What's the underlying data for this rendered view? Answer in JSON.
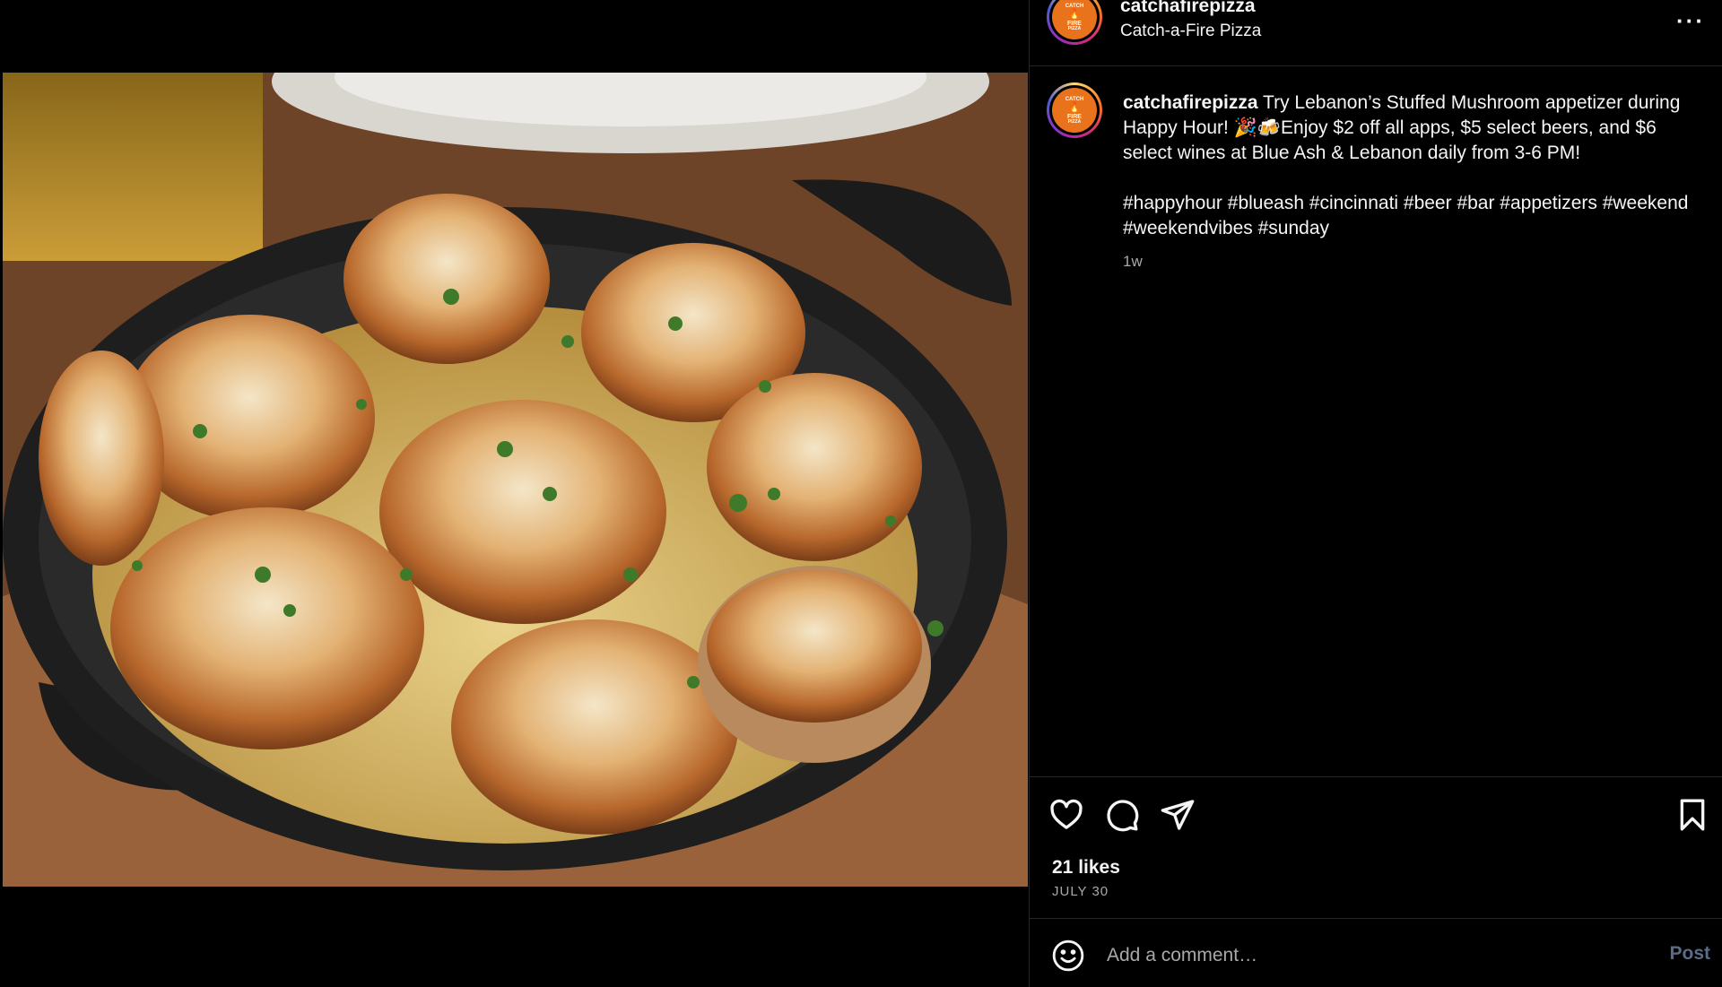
{
  "post_image": {
    "alt": "Stuffed mushrooms with melted cheese and herbs in a cast iron skillet"
  },
  "header": {
    "username": "catchafirepizza",
    "subtitle": "Catch-a-Fire Pizza",
    "more_icon": "more-horizontal-icon",
    "more_label": "···"
  },
  "avatar": {
    "line1": "CATCH",
    "line2": "FIRE",
    "line3": "PIZZA"
  },
  "caption": {
    "username": "catchafirepizza",
    "text": "Try Lebanon’s Stuffed Mushroom appetizer during Happy Hour! 🎉🍻Enjoy $2 off all apps, $5 select beers, and $6 select wines at Blue Ash & Lebanon daily from 3-6 PM!",
    "hashtags": "#happyhour #blueash #cincinnati #beer #bar #appetizers #weekend #weekendvibes #sunday",
    "time": "1w"
  },
  "actions": {
    "like_icon": "heart-icon",
    "comment_icon": "comment-icon",
    "share_icon": "share-icon",
    "save_icon": "bookmark-icon",
    "likes": "21 likes",
    "date": "JULY 30"
  },
  "comment": {
    "emoji_icon": "emoji-icon",
    "placeholder": "Add a comment…",
    "post_label": "Post"
  },
  "colors": {
    "background": "#000000",
    "text": "#f5f5f5",
    "secondary_text": "#a8a8a8",
    "divider": "#262626",
    "post_button": "#5b6b88",
    "brand_orange": "#e8731c"
  }
}
